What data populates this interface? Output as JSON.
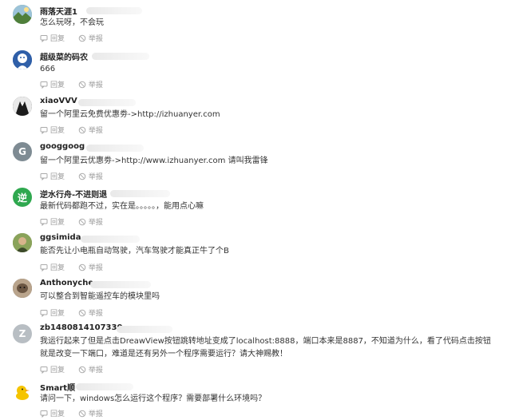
{
  "actions": {
    "reply": "回复",
    "report": "举报"
  },
  "comments": [
    {
      "user": "雨落天涯1",
      "text": "怎么玩呀，不会玩",
      "avatar": {
        "icon": "landscape-avatar",
        "color": "#6f9a5a"
      }
    },
    {
      "user": "超级菜的码农",
      "text": "666",
      "avatar": {
        "icon": "cartoon-avatar",
        "color": "#2f5fa8"
      }
    },
    {
      "user": "xiaoVVV",
      "text": "留一个阿里云免费优惠劵->http://izhuanyer.com",
      "avatar": {
        "icon": "suit-avatar",
        "color": "#1f1f1f"
      }
    },
    {
      "user": "googgoog",
      "text": "留一个阿里云优惠劵->http://www.izhuanyer.com 请叫我雷锋",
      "avatar": {
        "letter": "G",
        "color": "#7e8b93"
      }
    },
    {
      "user": "逆水行舟-不进则退",
      "text": "最新代码都跑不过，实在是。。。。。，能用点心嘛",
      "avatar": {
        "letter": "逆",
        "color": "#2fa84f"
      }
    },
    {
      "user": "ggsimida",
      "text": "能否先让小电瓶自动驾驶，汽车驾驶才能真正牛了个B",
      "avatar": {
        "icon": "photo-avatar",
        "color": "#6b7f3e"
      }
    },
    {
      "user": "Anthonyche",
      "text": "可以整合到智能遥控车的模块里吗",
      "avatar": {
        "icon": "photo-avatar",
        "color": "#5b4a3c"
      }
    },
    {
      "user": "zb1480814107330",
      "text": "我运行起来了但是点击DreawView按钮跳转地址变成了localhost:8888，端口本来是8887，不知道为什么，看了代码点击按钮就是改变一下端口，难道是还有另外一个程序需要运行？请大神赐教！",
      "avatar": {
        "letter": "Z",
        "color": "#b8bec3"
      }
    },
    {
      "user": "Smart顺",
      "text": "请问一下，windows怎么运行这个程序？需要部署什么环境吗？",
      "avatar": {
        "icon": "duck-avatar",
        "color": "#f2c200"
      }
    }
  ]
}
